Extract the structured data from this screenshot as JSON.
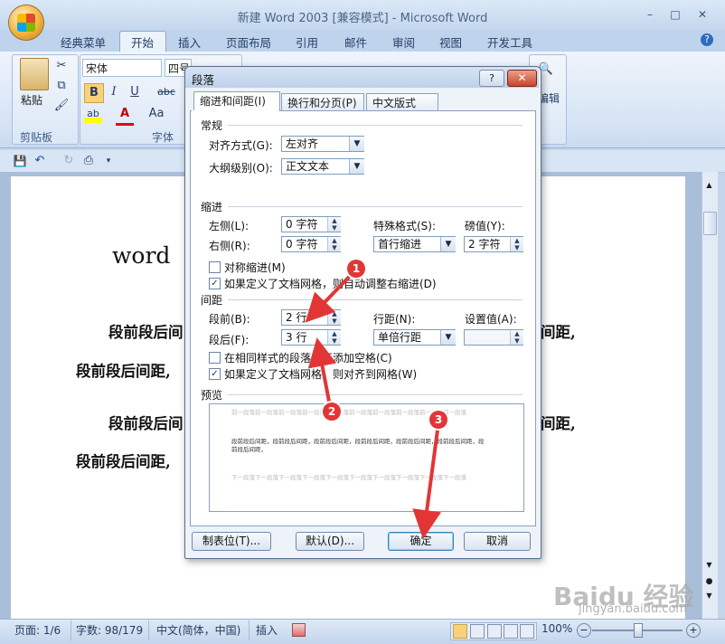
{
  "window": {
    "title": "新建 Word 2003 [兼容模式] - Microsoft Word",
    "minimize": "–",
    "maximize": "□",
    "close": "✕"
  },
  "ribbon": {
    "tabs": [
      "经典菜单",
      "开始",
      "插入",
      "页面布局",
      "引用",
      "邮件",
      "审阅",
      "视图",
      "开发工具"
    ],
    "active_tab": "开始",
    "clipboard": {
      "paste": "粘贴",
      "group_label": "剪贴板"
    },
    "font": {
      "name": "宋体",
      "size": "四号",
      "group_label": "字体",
      "bold": "B",
      "italic": "I",
      "underline": "U",
      "strike": "abc",
      "font_color_a": "A",
      "char_scale": "Aa"
    },
    "edit_label": "编辑"
  },
  "document": {
    "title_fragment": "word",
    "lines": [
      "段前段后间",
      "段前段后间距,",
      "段前段后间",
      "段前段后间距,"
    ],
    "lines_right": [
      "间距,",
      "间距,"
    ]
  },
  "dialog": {
    "title": "段落",
    "help": "?",
    "close": "✕",
    "tabs": [
      "缩进和间距(I)",
      "换行和分页(P)",
      "中文版式(H)"
    ],
    "general": {
      "heading": "常规",
      "alignment_label": "对齐方式(G):",
      "alignment_value": "左对齐",
      "outline_label": "大纲级别(O):",
      "outline_value": "正文文本"
    },
    "indent": {
      "heading": "缩进",
      "left_label": "左侧(L):",
      "left_value": "0 字符",
      "right_label": "右侧(R):",
      "right_value": "0 字符",
      "special_label": "特殊格式(S):",
      "special_value": "首行缩进",
      "by_label": "磅值(Y):",
      "by_value": "2 字符",
      "mirror_label": "对称缩进(M)",
      "auto_adjust_label": "如果定义了文档网格，则自动调整右缩进(D)"
    },
    "spacing": {
      "heading": "间距",
      "before_label": "段前(B):",
      "before_value": "2 行",
      "after_label": "段后(F):",
      "after_value": "3 行",
      "line_label": "行距(N):",
      "line_value": "单倍行距",
      "at_label": "设置值(A):",
      "at_value": "",
      "no_space_label": "在相同样式的段落间不添加空格(C)",
      "snap_grid_label": "如果定义了文档网格，则对齐到网格(W)"
    },
    "preview": {
      "heading": "预览",
      "prev_text": "前一段落前一段落前一段落前一段落前一段落前一段落前一段落前一段落前一段落前一段落",
      "sample_text": "段前段后间距，段前段后间距，段前段后间距，段前段后间距，段前段后间距，段前段后间距，段前段后间距，",
      "next_text": "下一段落下一段落下一段落下一段落下一段落下一段落下一段落下一段落下一段落下一段落"
    },
    "buttons": {
      "tabs": "制表位(T)...",
      "default": "默认(D)...",
      "ok": "确定",
      "cancel": "取消"
    }
  },
  "annotations": [
    "1",
    "2",
    "3"
  ],
  "status_bar": {
    "page": "页面: 1/6",
    "words": "字数: 98/179",
    "language": "中文(简体，中国)",
    "mode": "插入",
    "zoom": "100%"
  },
  "watermark": {
    "brand": "Baidu 经验",
    "url": "jingyan.baidu.com"
  },
  "colors": {
    "annotation": "#e23636",
    "ribbon": "#dbe7f6",
    "dialog_bg": "#eef3fa"
  }
}
